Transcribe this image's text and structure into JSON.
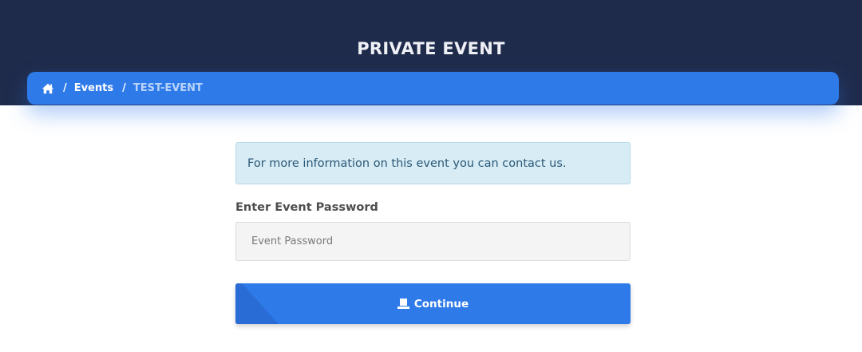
{
  "header": {
    "title": "PRIVATE EVENT"
  },
  "breadcrumb": {
    "home_icon": "home-icon",
    "separator": "/",
    "items": [
      {
        "label": "Events"
      },
      {
        "label": "TEST-EVENT"
      }
    ]
  },
  "alert": {
    "text": "For more information on this event you can contact us."
  },
  "form": {
    "password_label": "Enter Event Password",
    "password_placeholder": "Event Password",
    "password_value": "",
    "submit_label": "Continue",
    "submit_icon": "ticket-icon"
  },
  "colors": {
    "header_bg": "#1f2b4b",
    "accent": "#2f7ae9",
    "alert_bg": "#d7ecf5",
    "alert_text": "#2b5877"
  }
}
